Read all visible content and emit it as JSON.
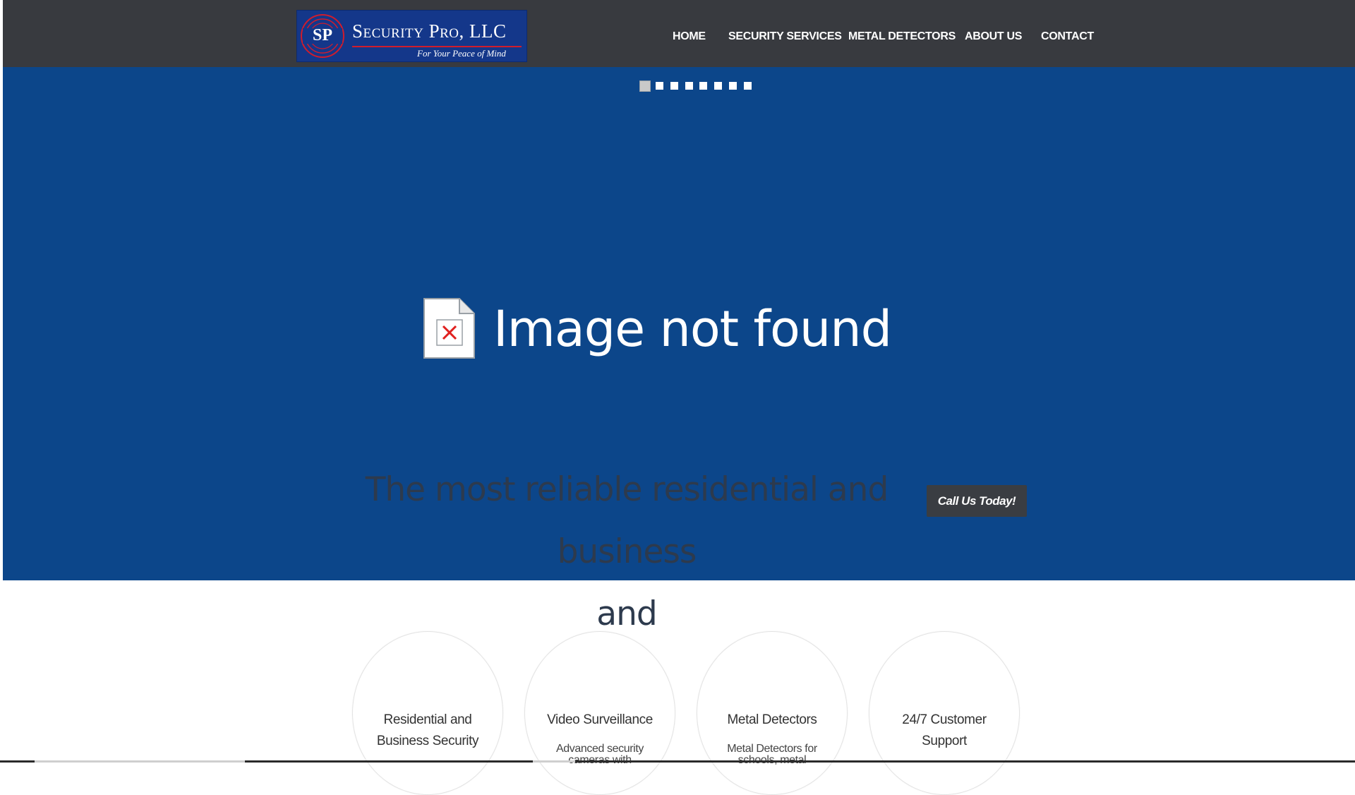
{
  "header": {
    "logo": {
      "name": "Security Pro, LLC",
      "tagline": "For Your Peace of Mind",
      "monogram": "SP"
    },
    "nav": [
      {
        "label": "HOME"
      },
      {
        "label": "SECURITY SERVICES"
      },
      {
        "label": "METAL DETECTORS"
      },
      {
        "label": "ABOUT US"
      },
      {
        "label": "CONTACT"
      }
    ]
  },
  "hero": {
    "slider_dot_count": 8,
    "active_slide": 1,
    "broken_image_text": "Image not found",
    "broken_image_icon": "broken-image-icon",
    "tagline_line1": "The most reliable residential and business",
    "tagline_line2": "and",
    "cta_label": "Call Us Today!"
  },
  "features": [
    {
      "title_line1": "Residential and",
      "title_line2": "Business Security",
      "desc": ""
    },
    {
      "title_line1": "Video Surveillance",
      "title_line2": "",
      "desc": "Advanced security cameras with"
    },
    {
      "title_line1": "Metal Detectors",
      "title_line2": "",
      "desc": "Metal Detectors for schools, metal"
    },
    {
      "title_line1": "24/7 Customer",
      "title_line2": "Support",
      "desc": ""
    }
  ],
  "colors": {
    "header_bg": "#383a3f",
    "hero_bg": "#0c468a",
    "logo_bg": "#14378a",
    "accent_red": "#d11c2c",
    "cta_bg": "#3a3d42"
  }
}
